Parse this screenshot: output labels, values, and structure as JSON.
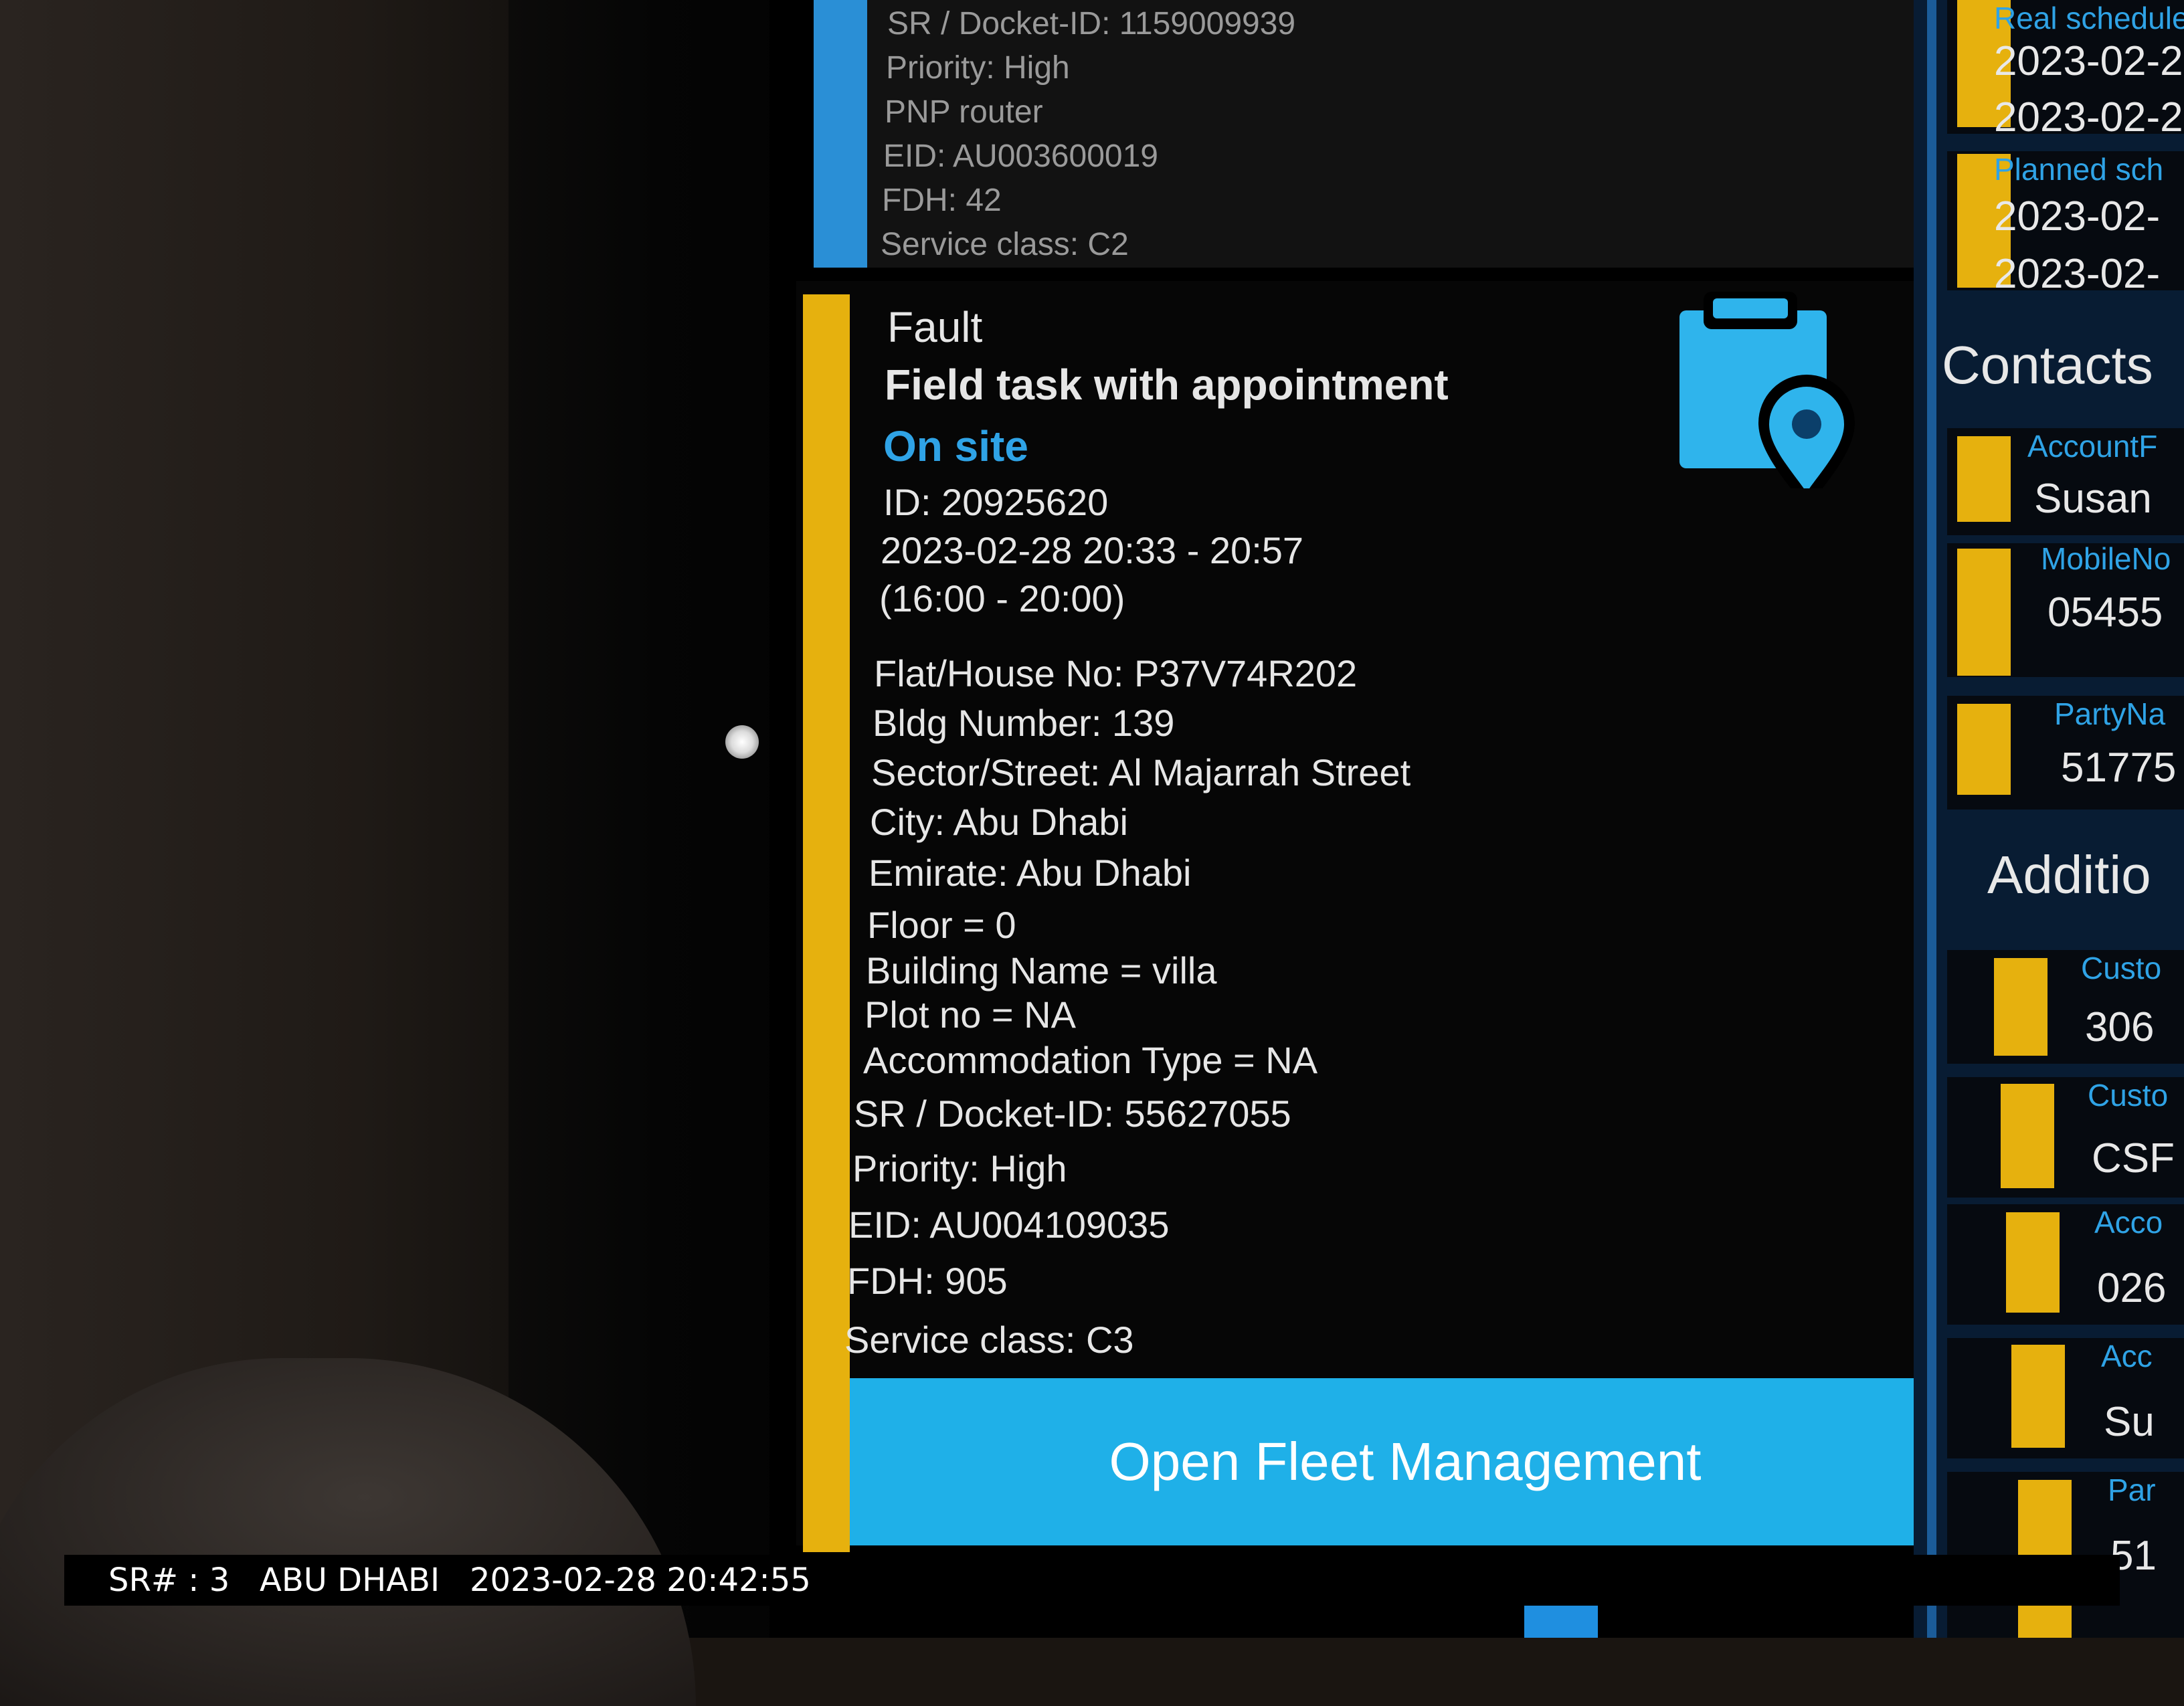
{
  "previous_card": {
    "lines": [
      "SR / Docket-ID: 1159009939",
      "Priority: High",
      "PNP router",
      "EID: AU003600019",
      "FDH: 42",
      "Service class: C2"
    ]
  },
  "task": {
    "type": "Fault",
    "title": "Field task with appointment",
    "status": "On site",
    "id_line": "ID: 20925620",
    "time_line": "2023-02-28 20:33 - 20:57",
    "window_line": "(16:00 - 20:00)",
    "icon": "clipboard-location-icon",
    "details": [
      "Flat/House No: P37V74R202",
      "Bldg Number: 139",
      "Sector/Street: Al Majarrah Street",
      "City: Abu Dhabi",
      "Emirate: Abu Dhabi",
      "Floor = 0",
      "Building Name = villa",
      "Plot no = NA",
      "Accommodation Type = NA",
      "SR / Docket-ID: 55627055",
      "Priority: High",
      "EID: AU004109035",
      "FDH: 905",
      "Service class: C3"
    ],
    "button_label": "Open Fleet Management"
  },
  "right_panel": {
    "schedule": [
      {
        "label": "Real schedule",
        "values": [
          "2023-02-2",
          "2023-02-2"
        ]
      },
      {
        "label": "Planned sch",
        "values": [
          "2023-02-",
          "2023-02-"
        ]
      }
    ],
    "contacts_heading": "Contacts",
    "contacts": [
      {
        "label": "AccountF",
        "value": "Susan"
      },
      {
        "label": "MobileNo",
        "value": "05455"
      },
      {
        "label": "PartyNa",
        "value": "51775"
      }
    ],
    "additional_heading": "Additio",
    "additional": [
      {
        "label": "Custo",
        "value": "306"
      },
      {
        "label": "Custo",
        "value": "CSF"
      },
      {
        "label": "Acco",
        "value": "026"
      },
      {
        "label": "Acc",
        "value": "Su"
      },
      {
        "label": "Par",
        "value": "51"
      }
    ]
  },
  "overlay": {
    "sr": "SR# : 3",
    "city": "ABU DHABI",
    "datetime": "2023-02-28 20:42:55"
  },
  "colors": {
    "accent_yellow": "#e6b10e",
    "accent_blue": "#2fa3e6",
    "button_blue": "#1fb0e8",
    "background": "#000000"
  }
}
